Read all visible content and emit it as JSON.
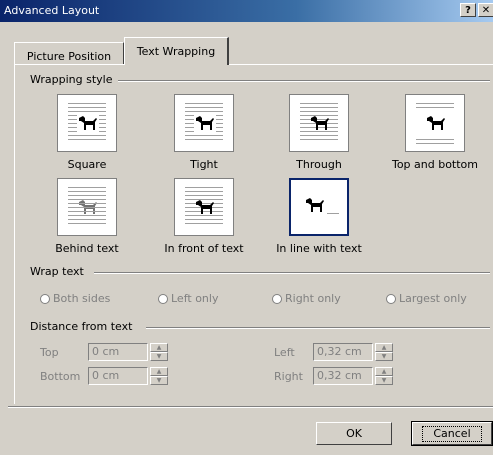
{
  "window": {
    "title": "Advanced Layout",
    "help_label": "?",
    "close_label": "✕"
  },
  "tabs": [
    {
      "label": "Picture Position",
      "active": false
    },
    {
      "label": "Text Wrapping",
      "active": true
    }
  ],
  "wrapping_style": {
    "heading": "Wrapping style",
    "options": [
      {
        "label": "Square",
        "icon": "wrap-square-icon",
        "selected": false
      },
      {
        "label": "Tight",
        "icon": "wrap-tight-icon",
        "selected": false
      },
      {
        "label": "Through",
        "icon": "wrap-through-icon",
        "selected": false
      },
      {
        "label": "Top and bottom",
        "icon": "wrap-top-bottom-icon",
        "selected": false
      },
      {
        "label": "Behind text",
        "icon": "wrap-behind-text-icon",
        "selected": false
      },
      {
        "label": "In front of text",
        "icon": "wrap-in-front-icon",
        "selected": false
      },
      {
        "label": "In line with text",
        "icon": "wrap-inline-icon",
        "selected": true
      }
    ]
  },
  "wrap_text": {
    "heading": "Wrap text",
    "options": [
      {
        "label": "Both sides",
        "enabled": false
      },
      {
        "label": "Left only",
        "enabled": false
      },
      {
        "label": "Right only",
        "enabled": false
      },
      {
        "label": "Largest only",
        "enabled": false
      }
    ]
  },
  "distance": {
    "heading": "Distance from text",
    "top": {
      "label": "Top",
      "value": "0 cm"
    },
    "bottom": {
      "label": "Bottom",
      "value": "0 cm"
    },
    "left": {
      "label": "Left",
      "value": "0,32 cm"
    },
    "right": {
      "label": "Right",
      "value": "0,32 cm"
    }
  },
  "buttons": {
    "ok": "OK",
    "cancel": "Cancel"
  }
}
